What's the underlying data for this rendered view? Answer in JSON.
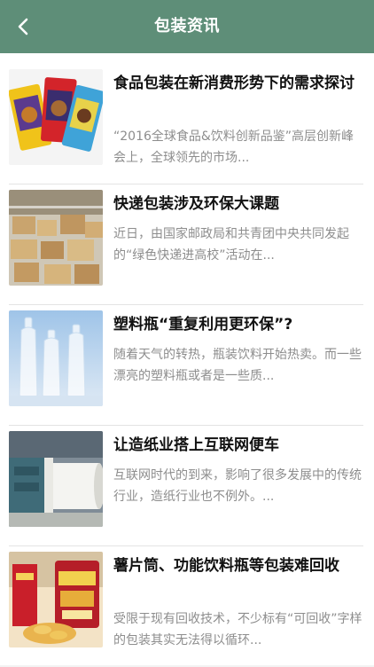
{
  "header": {
    "title": "包装资讯",
    "back_icon": "chevron-left-icon"
  },
  "colors": {
    "header_bg": "#5e8e78",
    "title_text": "#111111",
    "desc_text": "#8d8d8d"
  },
  "articles": [
    {
      "title": "食品包装在新消费形势下的需求探讨",
      "summary": "“2016全球食品&饮料创新品鉴”高层创新峰会上，全球领先的市场..."
    },
    {
      "title": "快递包装涉及环保大课题",
      "summary": "近日，由国家邮政局和共青团中央共同发起的“绿色快递进高校”活动在..."
    },
    {
      "title": "塑料瓶“重复利用更环保”?",
      "summary": "随着天气的转热，瓶装饮料开始热卖。而一些漂亮的塑料瓶或者是一些质..."
    },
    {
      "title": "让造纸业搭上互联网便车",
      "summary": "互联网时代的到来，影响了很多发展中的传统行业，造纸行业也不例外。..."
    },
    {
      "title": "薯片筒、功能饮料瓶等包装难回收",
      "summary": "受限于现有回收技术，不少标有“可回收”字样的包装其实无法得以循环..."
    }
  ]
}
